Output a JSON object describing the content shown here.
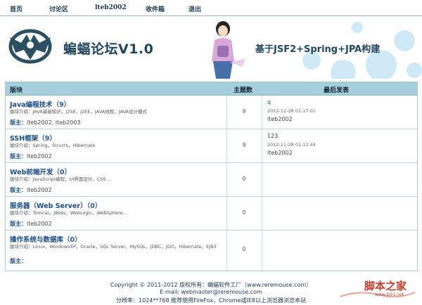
{
  "nav": {
    "items": [
      "首页",
      "讨论区",
      "lteb2002",
      "收件箱",
      "退出"
    ]
  },
  "banner": {
    "title": "蝙蝠论坛V1.0",
    "slogan": "基于JSF2+Spring+JPA构建"
  },
  "table": {
    "headers": {
      "board": "版块",
      "topics": "主题数",
      "last": "最后发表"
    },
    "rows": [
      {
        "name": "Java编程技术",
        "count": "（9）",
        "desc": "版块介绍：JAVA基础知识，J2SE，J2EE，JAVA线程，JAVA设计模式",
        "moderator_label": "版主：",
        "moderators": "lteb2002, lteb2003",
        "topics": "9",
        "last_title": "q",
        "last_time": "2012-12-28 02:17:01",
        "last_user": "lteb2002"
      },
      {
        "name": "SSH框架",
        "count": "（9）",
        "desc": "版块介绍：Spring，Structs，Hibernate",
        "moderator_label": "版主：",
        "moderators": "lteb2002",
        "topics": "9",
        "last_title": "123",
        "last_time": "2012-11-28 01:12:44",
        "last_user": "lteb2002"
      },
      {
        "name": "Web前端开发",
        "count": "（0）",
        "desc": "版块介绍：JavaScript编程，UI界面设计，CSS ...",
        "moderator_label": "版主：",
        "moderators": "lteb2002",
        "topics": "0",
        "last_title": "",
        "last_time": "",
        "last_user": ""
      },
      {
        "name": "服务器（Web Server）",
        "count": "（0）",
        "desc": "版块介绍：Tomcat，JBoss，WebLogic，WebSphere...",
        "moderator_label": "版主：",
        "moderators": "lteb2002",
        "topics": "0",
        "last_title": "",
        "last_time": "",
        "last_user": ""
      },
      {
        "name": "操作系统与数据库",
        "count": "（0）",
        "desc": "版块介绍：Linux，WindowsXP，Oracle，SQL Server，MySQL，JDBC，JDO，Hibernate，EJB3",
        "moderator_label": "版主：",
        "moderators": "",
        "topics": "0",
        "last_title": "",
        "last_time": "",
        "last_user": ""
      }
    ]
  },
  "footer": {
    "copyright": "Copyright © 2011-2012 版权所有：蝙蝠软件工厂（www.reremouse.com）",
    "email": "E-mail: webmaster@reremouse.com",
    "resolution": "分辨率：1024**768  推荐使用FireFox、Chrome或IE8以上浏览器浏览本站"
  },
  "watermark": {
    "text": "脚本之家",
    "url": "www.jb51.net"
  },
  "colors": {
    "header_bg": "#a6cfdc",
    "title": "#1f4760",
    "link": "#1a4c87"
  }
}
